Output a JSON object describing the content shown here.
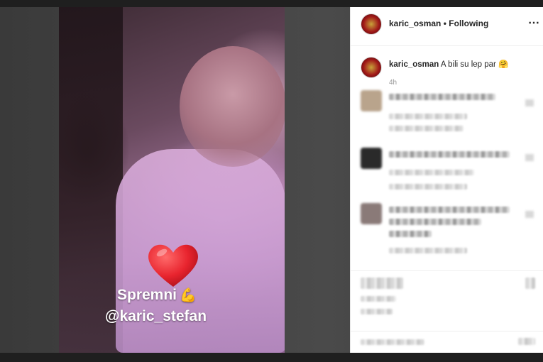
{
  "story": {
    "caption_text": "Spremni",
    "caption_emoji": "💪",
    "mention": "@karic_stefan",
    "heart_color": "#e8242e"
  },
  "post": {
    "username": "karic_osman",
    "follow_state": "Following",
    "more_icon": "⋯",
    "caption_username": "karic_osman",
    "caption_text": "A bili su lep par",
    "caption_emoji": "🤗",
    "time_ago": "4h"
  }
}
